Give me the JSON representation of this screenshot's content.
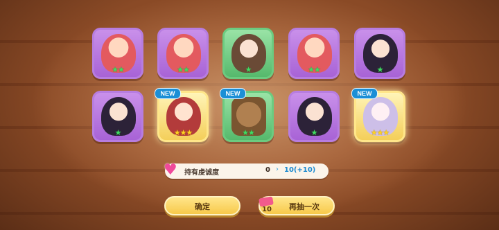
{
  "cards": [
    {
      "id": "c1",
      "frame": "purple",
      "art": "hair-red",
      "stars": "★★",
      "star_color": "green",
      "new": false
    },
    {
      "id": "c2",
      "frame": "purple",
      "art": "hair-red",
      "stars": "★★",
      "star_color": "green",
      "new": false
    },
    {
      "id": "c3",
      "frame": "green",
      "art": "hair-brown",
      "stars": "★",
      "star_color": "green",
      "new": false
    },
    {
      "id": "c4",
      "frame": "purple",
      "art": "hair-red",
      "stars": "★★",
      "star_color": "green",
      "new": false
    },
    {
      "id": "c5",
      "frame": "purple",
      "art": "hair-black",
      "stars": "★",
      "star_color": "green",
      "new": false
    },
    {
      "id": "c6",
      "frame": "purple",
      "art": "hair-black",
      "stars": "★",
      "star_color": "green",
      "new": false
    },
    {
      "id": "c7",
      "frame": "gold",
      "art": "devil",
      "stars": "★★★",
      "star_color": "yellow",
      "new": true
    },
    {
      "id": "c8",
      "frame": "green",
      "art": "tree",
      "stars": "★★",
      "star_color": "green",
      "new": true
    },
    {
      "id": "c9",
      "frame": "purple",
      "art": "hair-black",
      "stars": "★",
      "star_color": "green",
      "new": false
    },
    {
      "id": "c10",
      "frame": "gold",
      "art": "silver",
      "stars": "★★★",
      "star_color": "yellow",
      "new": true
    }
  ],
  "new_label": "NEW",
  "piety": {
    "label": "持有虔诚度",
    "current": "0",
    "arrow": "›",
    "next": "10(+10)",
    "icon": "heart-icon"
  },
  "buttons": {
    "confirm": "确定",
    "retry": "再抽一次",
    "retry_cost": "10"
  }
}
